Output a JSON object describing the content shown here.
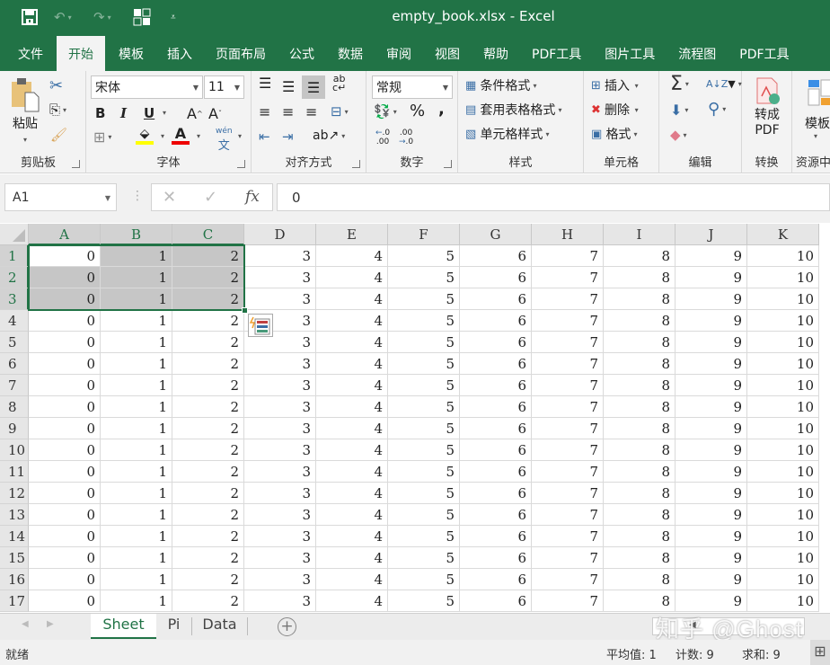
{
  "window": {
    "title": "empty_book.xlsx  -  Excel"
  },
  "qat": {
    "save_icon": "save-icon",
    "undo_icon": "undo-icon",
    "redo_icon": "redo-icon",
    "layout_icon": "touch-mode-icon",
    "customize_icon": "customize-qat-icon"
  },
  "tabs": [
    "文件",
    "开始",
    "模板",
    "插入",
    "页面布局",
    "公式",
    "数据",
    "审阅",
    "视图",
    "帮助",
    "PDF工具",
    "图片工具",
    "流程图",
    "PDF工具"
  ],
  "active_tab": "开始",
  "ribbon": {
    "clipboard": {
      "label": "剪贴板",
      "paste": "粘贴"
    },
    "font": {
      "label": "字体",
      "font_name": "宋体",
      "font_size": "11",
      "bold": "B",
      "italic": "I",
      "underline": "U",
      "grow": "A",
      "shrink": "A",
      "phonetic": "wén"
    },
    "alignment": {
      "label": "对齐方式"
    },
    "number": {
      "label": "数字",
      "format": "常规",
      "percent": "%",
      "comma": ","
    },
    "styles": {
      "label": "样式",
      "conditional": "条件格式",
      "table": "套用表格格式",
      "cell_styles": "单元格样式"
    },
    "cells": {
      "label": "单元格",
      "insert": "插入",
      "delete": "删除",
      "format": "格式"
    },
    "editing": {
      "label": "编辑",
      "sum": "Σ"
    },
    "convert": {
      "label": "转换",
      "to_pdf_line1": "转成",
      "to_pdf_line2": "PDF"
    },
    "resources": {
      "label": "资源中",
      "templates": "模板"
    }
  },
  "formula_bar": {
    "name_box": "A1",
    "cancel": "✕",
    "enter": "✓",
    "fx": "fx",
    "value": "0"
  },
  "columns": [
    "A",
    "B",
    "C",
    "D",
    "E",
    "F",
    "G",
    "H",
    "I",
    "J",
    "K"
  ],
  "selected_columns": [
    "A",
    "B",
    "C"
  ],
  "rows": [
    {
      "n": "1",
      "cells": [
        "0",
        "1",
        "2",
        "3",
        "4",
        "5",
        "6",
        "7",
        "8",
        "9",
        "10"
      ]
    },
    {
      "n": "2",
      "cells": [
        "0",
        "1",
        "2",
        "3",
        "4",
        "5",
        "6",
        "7",
        "8",
        "9",
        "10"
      ]
    },
    {
      "n": "3",
      "cells": [
        "0",
        "1",
        "2",
        "3",
        "4",
        "5",
        "6",
        "7",
        "8",
        "9",
        "10"
      ]
    },
    {
      "n": "4",
      "cells": [
        "0",
        "1",
        "2",
        "3",
        "4",
        "5",
        "6",
        "7",
        "8",
        "9",
        "10"
      ]
    },
    {
      "n": "5",
      "cells": [
        "0",
        "1",
        "2",
        "3",
        "4",
        "5",
        "6",
        "7",
        "8",
        "9",
        "10"
      ]
    },
    {
      "n": "6",
      "cells": [
        "0",
        "1",
        "2",
        "3",
        "4",
        "5",
        "6",
        "7",
        "8",
        "9",
        "10"
      ]
    },
    {
      "n": "7",
      "cells": [
        "0",
        "1",
        "2",
        "3",
        "4",
        "5",
        "6",
        "7",
        "8",
        "9",
        "10"
      ]
    },
    {
      "n": "8",
      "cells": [
        "0",
        "1",
        "2",
        "3",
        "4",
        "5",
        "6",
        "7",
        "8",
        "9",
        "10"
      ]
    },
    {
      "n": "9",
      "cells": [
        "0",
        "1",
        "2",
        "3",
        "4",
        "5",
        "6",
        "7",
        "8",
        "9",
        "10"
      ]
    },
    {
      "n": "10",
      "cells": [
        "0",
        "1",
        "2",
        "3",
        "4",
        "5",
        "6",
        "7",
        "8",
        "9",
        "10"
      ]
    },
    {
      "n": "11",
      "cells": [
        "0",
        "1",
        "2",
        "3",
        "4",
        "5",
        "6",
        "7",
        "8",
        "9",
        "10"
      ]
    },
    {
      "n": "12",
      "cells": [
        "0",
        "1",
        "2",
        "3",
        "4",
        "5",
        "6",
        "7",
        "8",
        "9",
        "10"
      ]
    },
    {
      "n": "13",
      "cells": [
        "0",
        "1",
        "2",
        "3",
        "4",
        "5",
        "6",
        "7",
        "8",
        "9",
        "10"
      ]
    },
    {
      "n": "14",
      "cells": [
        "0",
        "1",
        "2",
        "3",
        "4",
        "5",
        "6",
        "7",
        "8",
        "9",
        "10"
      ]
    },
    {
      "n": "15",
      "cells": [
        "0",
        "1",
        "2",
        "3",
        "4",
        "5",
        "6",
        "7",
        "8",
        "9",
        "10"
      ]
    },
    {
      "n": "16",
      "cells": [
        "0",
        "1",
        "2",
        "3",
        "4",
        "5",
        "6",
        "7",
        "8",
        "9",
        "10"
      ]
    },
    {
      "n": "17",
      "cells": [
        "0",
        "1",
        "2",
        "3",
        "4",
        "5",
        "6",
        "7",
        "8",
        "9",
        "10"
      ]
    }
  ],
  "selected_rows": [
    "1",
    "2",
    "3"
  ],
  "sheets": [
    "Sheet",
    "Pi",
    "Data"
  ],
  "active_sheet": "Sheet",
  "status": {
    "ready": "就绪",
    "average": "平均值: 1",
    "count": "计数: 9",
    "sum": "求和: 9"
  },
  "watermark": "知乎 @Ghost",
  "colors": {
    "accent": "#217346",
    "selection": "#c6c6c6"
  }
}
